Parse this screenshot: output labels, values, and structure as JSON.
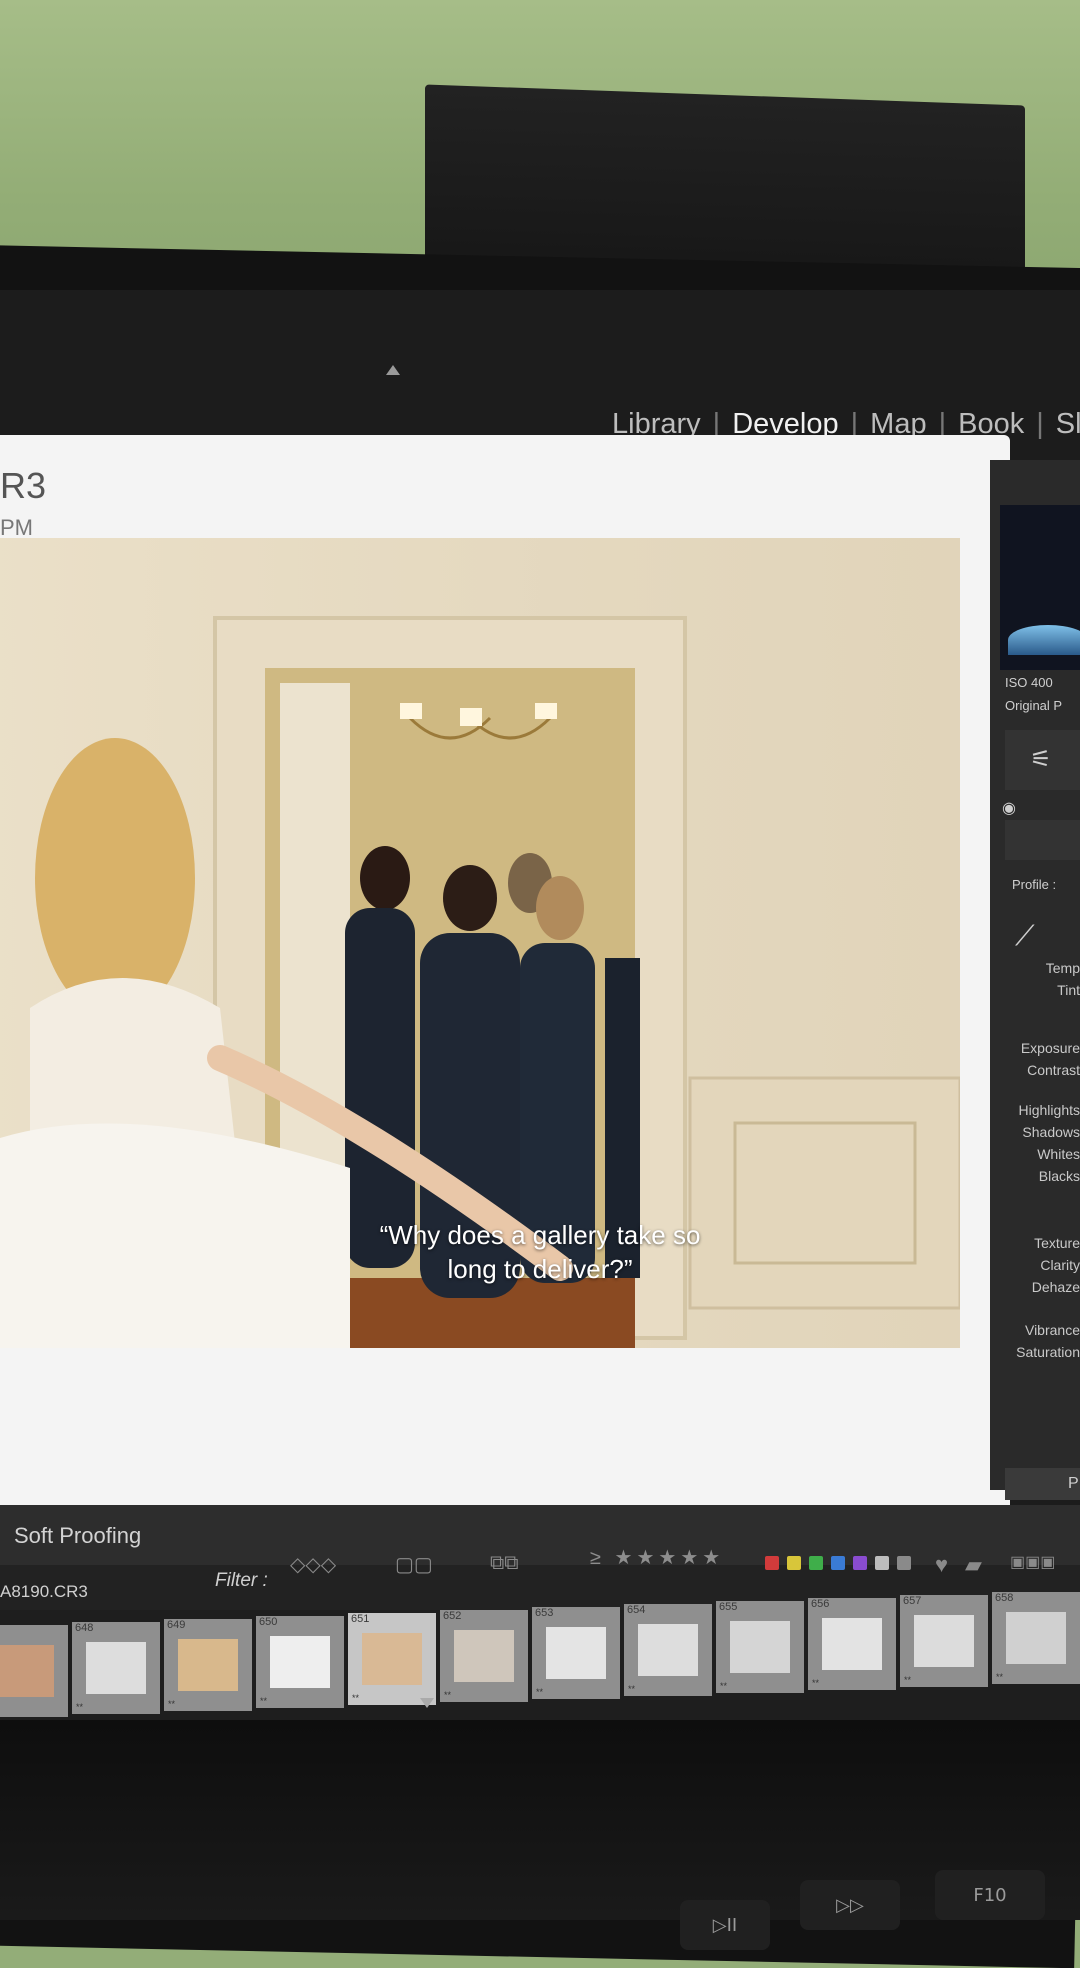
{
  "modules": [
    "Library",
    "Develop",
    "Map",
    "Book",
    "Slides"
  ],
  "active_module": "Develop",
  "image_header": {
    "filename_fragment": "R3",
    "time_fragment": "PM"
  },
  "caption": "“Why does a gallery take so long to deliver?”",
  "histogram": {
    "iso": "ISO 400",
    "original_photo": "Original P"
  },
  "right_panel": {
    "profile_label": "Profile :",
    "basic_labels": [
      "Temp",
      "Tint",
      "Exposure",
      "Contrast",
      "Highlights",
      "Shadows",
      "Whites",
      "Blacks",
      "Texture",
      "Clarity",
      "Dehaze",
      "Vibrance",
      "Saturation"
    ],
    "bottom_button": "P"
  },
  "toolbar": {
    "soft_proofing": "Soft Proofing"
  },
  "filmstrip": {
    "filter_label": "Filter :",
    "current_file": "A8190.CR3",
    "thumbnails": [
      {
        "num": "",
        "stars": "*"
      },
      {
        "num": "648",
        "stars": "**"
      },
      {
        "num": "649",
        "stars": "**"
      },
      {
        "num": "650",
        "stars": "**"
      },
      {
        "num": "651",
        "stars": "**",
        "selected": true
      },
      {
        "num": "652",
        "stars": "**"
      },
      {
        "num": "653",
        "stars": "**"
      },
      {
        "num": "654",
        "stars": "**"
      },
      {
        "num": "655",
        "stars": "**"
      },
      {
        "num": "656",
        "stars": "**"
      },
      {
        "num": "657",
        "stars": "**"
      },
      {
        "num": "658",
        "stars": "**"
      }
    ],
    "rating_filter": "≥ ★★★★★",
    "color_labels": [
      "#d23b3b",
      "#d8c63a",
      "#3fae4a",
      "#3a7bd5",
      "#8a4cd0",
      "#bdbdbd",
      "#8a8a8a"
    ]
  },
  "keyboard": {
    "keys": [
      "▷II",
      "▷▷",
      "F10"
    ]
  }
}
